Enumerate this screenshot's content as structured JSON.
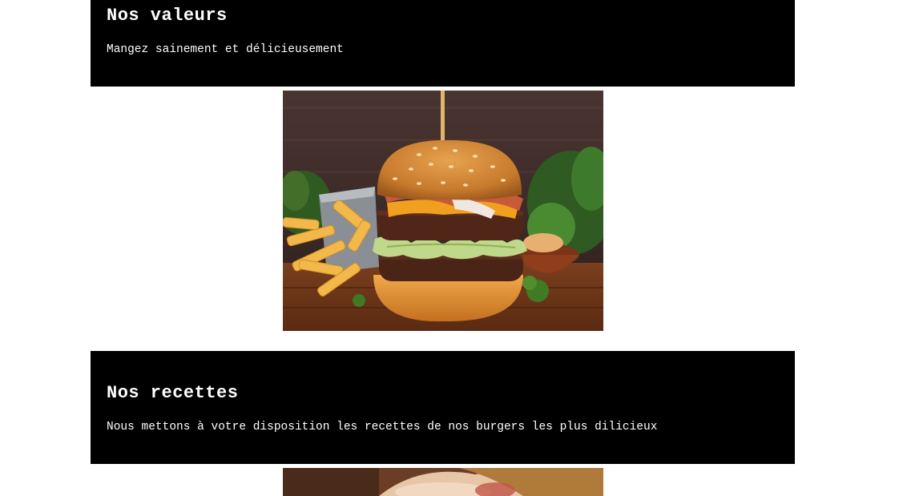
{
  "sections": [
    {
      "title": "Nos valeurs",
      "text": "Mangez sainement et délicieusement",
      "image": "burger-photo"
    },
    {
      "title": "Nos recettes",
      "text": "Nous mettons à votre disposition les recettes de nos burgers les plus dilicieux",
      "image": "burger-closeup-photo"
    }
  ],
  "colors": {
    "section_background": "#000000",
    "section_text": "#ffffff",
    "page_background": "#ffffff"
  }
}
